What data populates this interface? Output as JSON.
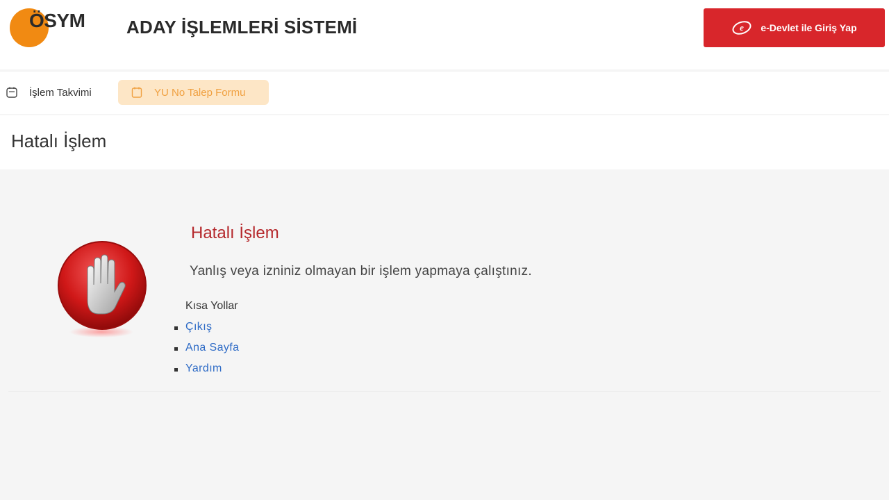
{
  "header": {
    "logo_text": "ÖSYM",
    "app_title": "ADAY İŞLEMLERİ SİSTEMİ",
    "login_button": "e-Devlet ile Giriş Yap"
  },
  "nav": {
    "items": [
      {
        "label": "İşlem Takvimi",
        "icon": "calendar-icon"
      },
      {
        "label": "YU No Talep Formu",
        "icon": "form-icon",
        "active": true
      }
    ]
  },
  "page": {
    "title": "Hatalı İşlem"
  },
  "error": {
    "title": "Hatalı İşlem",
    "message": "Yanlış veya izniniz olmayan bir işlem yapmaya çalıştınız.",
    "shortcuts_label": "Kısa Yollar",
    "links": [
      "Çıkış",
      "Ana Sayfa",
      "Yardım"
    ]
  },
  "colors": {
    "brand_orange": "#f18a12",
    "edevlet_red": "#d8262b",
    "error_red": "#b5282c",
    "link_blue": "#2e6bc6",
    "active_nav_bg": "#fde6c6"
  }
}
